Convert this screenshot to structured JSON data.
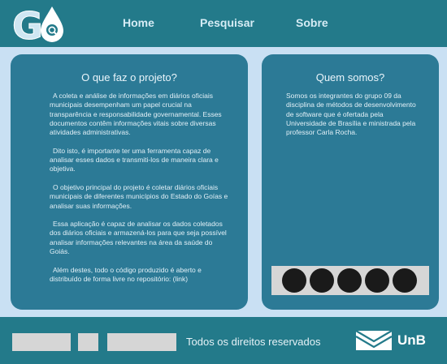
{
  "header": {
    "logo_letter": "G",
    "nav": {
      "home": "Home",
      "search": "Pesquisar",
      "about": "Sobre"
    }
  },
  "project": {
    "title": "O que faz o projeto?",
    "paragraphs": [
      "A coleta e análise de informações em diários oficiais municipais desempenham um papel crucial na transparência e responsabilidade governamental. Esses documentos contêm informações vitais sobre diversas atividades administrativas.",
      "Dito isto, é importante ter uma ferramenta capaz de analisar esses dados e transmiti-los de maneira clara e objetiva.",
      "O objetivo principal do projeto é coletar diários oficiais municipais de diferentes municípios do Estado do Goías e analisar suas informações.",
      "Essa aplicação é capaz de analisar os dados coletados dos diários oficiais e armazená-los para que seja possível analisar informações relevantes na área da saúde do Goiás.",
      "Além destes, todo o código produzido é aberto e distribuído de forma livre no repositório: (link)"
    ]
  },
  "about": {
    "title": "Quem somos?",
    "text": "Somos os integrantes do grupo 09 da disciplina de métodos de desenvolvimento de software que é ofertada pela Universidade de Brasília e ministrada pela professor Carla Rocha.",
    "member_count": 5
  },
  "footer": {
    "rights": "Todos os direitos reservados",
    "brand": "UnB"
  },
  "colors": {
    "header_bg": "#237a8a",
    "page_bg": "#c9e0f3",
    "panel_bg": "#2c7a96",
    "placeholder": "#d6d6d6"
  }
}
